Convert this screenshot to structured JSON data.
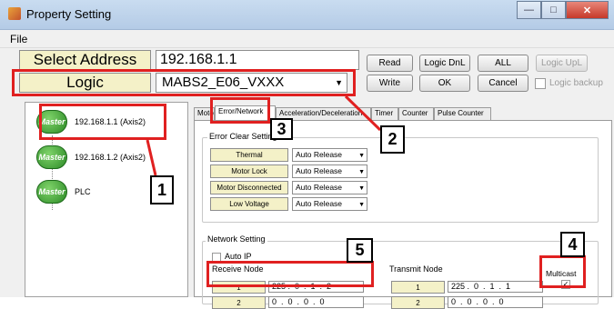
{
  "window": {
    "title": "Property Setting"
  },
  "menu": {
    "file": "File"
  },
  "form": {
    "select_address_label": "Select Address",
    "select_address_value": "192.168.1.1",
    "logic_label": "Logic",
    "logic_value": "MABS2_E06_VXXX"
  },
  "buttons": {
    "read": "Read",
    "logic_dnl": "Logic DnL",
    "all": "ALL",
    "logic_upl": "Logic UpL",
    "write": "Write",
    "ok": "OK",
    "cancel": "Cancel",
    "logic_backup": "Logic backup"
  },
  "tree": {
    "badge": "Master",
    "nodes": [
      {
        "label": "192.168.1.1 (Axis2)"
      },
      {
        "label": "192.168.1.2 (Axis2)"
      },
      {
        "label": "PLC"
      }
    ]
  },
  "tabs": [
    {
      "label": "Motor"
    },
    {
      "label": "Error/Network"
    },
    {
      "label": "Acceleration/Deceleration"
    },
    {
      "label": "Timer"
    },
    {
      "label": "Counter"
    },
    {
      "label": "Pulse Counter"
    }
  ],
  "error_clear": {
    "title": "Error Clear Setting",
    "rows": [
      {
        "label": "Thermal",
        "value": "Auto Release"
      },
      {
        "label": "Motor Lock",
        "value": "Auto Release"
      },
      {
        "label": "Motor Disconnected",
        "value": "Auto Release"
      },
      {
        "label": "Low Voltage",
        "value": "Auto Release"
      }
    ]
  },
  "network": {
    "title": "Network Setting",
    "auto_ip": "Auto IP",
    "receive_node_label": "Receive Node",
    "transmit_node_label": "Transmit Node",
    "multicast_label": "Multicast",
    "receive_rows": [
      {
        "index": "1",
        "ip": "225 .  0  .  1  .  2"
      },
      {
        "index": "2",
        "ip": "0  .  0  .  0  .  0"
      }
    ],
    "transmit_rows": [
      {
        "index": "1",
        "ip": "225 .  0  .  1  .  1"
      },
      {
        "index": "2",
        "ip": "0  .  0  .  0  .  0"
      }
    ]
  },
  "callouts": [
    "1",
    "2",
    "3",
    "4",
    "5"
  ],
  "colors": {
    "highlight": "#e02020",
    "label_bg": "#f4f1c8",
    "master_green": "#2c8a26"
  }
}
